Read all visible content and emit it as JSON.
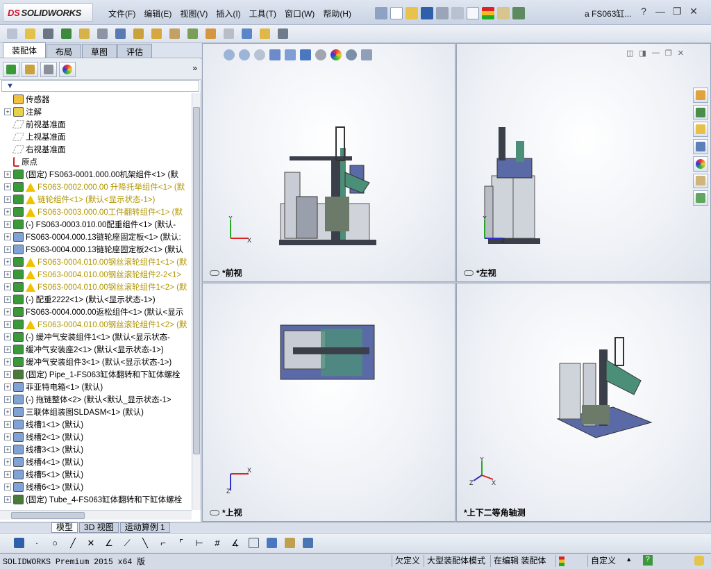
{
  "app": {
    "logo_mark": "DS",
    "logo_text": "SOLIDWORKS",
    "doc_title": "a  FS063缸..."
  },
  "menu": [
    "文件(F)",
    "编辑(E)",
    "视图(V)",
    "插入(I)",
    "工具(T)",
    "窗口(W)",
    "帮助(H)"
  ],
  "window_controls": {
    "help": "?",
    "minimize": "—",
    "restore": "❐",
    "close": "✕"
  },
  "feature_manager": {
    "tabs": [
      "装配体",
      "布局",
      "草图",
      "评估"
    ],
    "active_tab": 0,
    "expand_arrow": "»",
    "filter_symbol": "▼",
    "tree": [
      {
        "label": "传感器",
        "expand": false,
        "icon": "sensor",
        "warn": false
      },
      {
        "label": "注解",
        "expand": true,
        "icon": "annotation",
        "warn": false
      },
      {
        "label": "前视基准面",
        "expand": false,
        "icon": "plane",
        "warn": false
      },
      {
        "label": "上视基准面",
        "expand": false,
        "icon": "plane",
        "warn": false
      },
      {
        "label": "右视基准面",
        "expand": false,
        "icon": "plane",
        "warn": false
      },
      {
        "label": "原点",
        "expand": false,
        "icon": "origin",
        "warn": false
      },
      {
        "label": "(固定) FS063-0001.000.00机架组件<1> (默",
        "expand": true,
        "icon": "assembly",
        "warn": false
      },
      {
        "label": "FS063-0002.000.00 升降托举组件<1> (默",
        "expand": true,
        "icon": "assembly",
        "warn": true
      },
      {
        "label": "链轮组件<1> (默认<显示状态-1>)",
        "expand": true,
        "icon": "assembly",
        "warn": true
      },
      {
        "label": "FS063-0003.000.00工件翻转组件<1> (默",
        "expand": true,
        "icon": "assembly",
        "warn": true
      },
      {
        "label": "(-) FS063-0003.010.00配重组件<1> (默认-",
        "expand": true,
        "icon": "assembly",
        "warn": false
      },
      {
        "label": "FS063-0004.000.13链轮座固定板<1> (默认:",
        "expand": true,
        "icon": "part",
        "warn": false
      },
      {
        "label": "FS063-0004.000.13链轮座固定板2<1> (默认",
        "expand": true,
        "icon": "part",
        "warn": false
      },
      {
        "label": "FS063-0004.010.00钢丝滚轮组件1<1> (默",
        "expand": true,
        "icon": "assembly",
        "warn": true
      },
      {
        "label": "FS063-0004.010.00钢丝滚轮组件2-2<1>",
        "expand": true,
        "icon": "assembly",
        "warn": true
      },
      {
        "label": "FS063-0004.010.00钢丝滚轮组件1<2> (默",
        "expand": true,
        "icon": "assembly",
        "warn": true
      },
      {
        "label": "(-) 配重2222<1> (默认<显示状态-1>)",
        "expand": true,
        "icon": "assembly",
        "warn": false
      },
      {
        "label": "FS063-0004.000.00返松组件<1> (默认<显示",
        "expand": true,
        "icon": "assembly",
        "warn": false
      },
      {
        "label": "FS063-0004.010.00钢丝滚轮组件1<2> (默",
        "expand": true,
        "icon": "assembly",
        "warn": true
      },
      {
        "label": "(-) 缓冲气安装组件1<1> (默认<显示状态-",
        "expand": true,
        "icon": "assembly",
        "warn": false
      },
      {
        "label": "缓冲气安装座2<1> (默认<显示状态-1>)",
        "expand": true,
        "icon": "assembly",
        "warn": false
      },
      {
        "label": "缓冲气安装组件3<1> (默认<显示状态-1>)",
        "expand": true,
        "icon": "assembly",
        "warn": false
      },
      {
        "label": "(固定) Pipe_1-FS063缸体翻转和下缸体螺栓",
        "expand": true,
        "icon": "pipe",
        "warn": false
      },
      {
        "label": "菲亚特电箱<1> (默认)",
        "expand": true,
        "icon": "part",
        "warn": false
      },
      {
        "label": "(-) 拖链整体<2> (默认<默认_显示状态-1>",
        "expand": true,
        "icon": "part",
        "warn": false
      },
      {
        "label": "三联体组装图SLDASM<1> (默认)",
        "expand": true,
        "icon": "part",
        "warn": false
      },
      {
        "label": "线槽1<1> (默认)",
        "expand": true,
        "icon": "part",
        "warn": false
      },
      {
        "label": "线槽2<1> (默认)",
        "expand": true,
        "icon": "part",
        "warn": false
      },
      {
        "label": "线槽3<1> (默认)",
        "expand": true,
        "icon": "part",
        "warn": false
      },
      {
        "label": "线槽4<1> (默认)",
        "expand": true,
        "icon": "part",
        "warn": false
      },
      {
        "label": "线槽5<1> (默认)",
        "expand": true,
        "icon": "part",
        "warn": false
      },
      {
        "label": "线槽6<1> (默认)",
        "expand": true,
        "icon": "part",
        "warn": false
      },
      {
        "label": "(固定) Tube_4-FS063缸体翻转和下缸体螺栓",
        "expand": true,
        "icon": "pipe",
        "warn": false
      }
    ]
  },
  "viewports": [
    {
      "label": "*前视",
      "axes": [
        "Y",
        "X"
      ]
    },
    {
      "label": "*左视",
      "axes": [
        "Y",
        "Z"
      ]
    },
    {
      "label": "*上视",
      "axes": [
        "X",
        "Z"
      ]
    },
    {
      "label": "*上下二等角轴测",
      "axes": [
        "Y",
        "X",
        "Z"
      ]
    }
  ],
  "bottom_tabs": [
    "模型",
    "3D 视图",
    "运动算例 1"
  ],
  "active_bottom_tab": 0,
  "status": {
    "product": "SOLIDWORKS Premium 2015 x64 版",
    "undefined": "欠定义",
    "large_asm": "大型装配体模式",
    "editing": "在编辑 装配体",
    "custom": "自定义",
    "caret": "▲",
    "help": "?"
  },
  "colors": {
    "warning_text": "#b19500",
    "machine_dark": "#3a3f4a",
    "machine_green": "#4c8f79",
    "machine_blue": "#5a6aa6",
    "machine_gray": "#c8ccd4"
  }
}
